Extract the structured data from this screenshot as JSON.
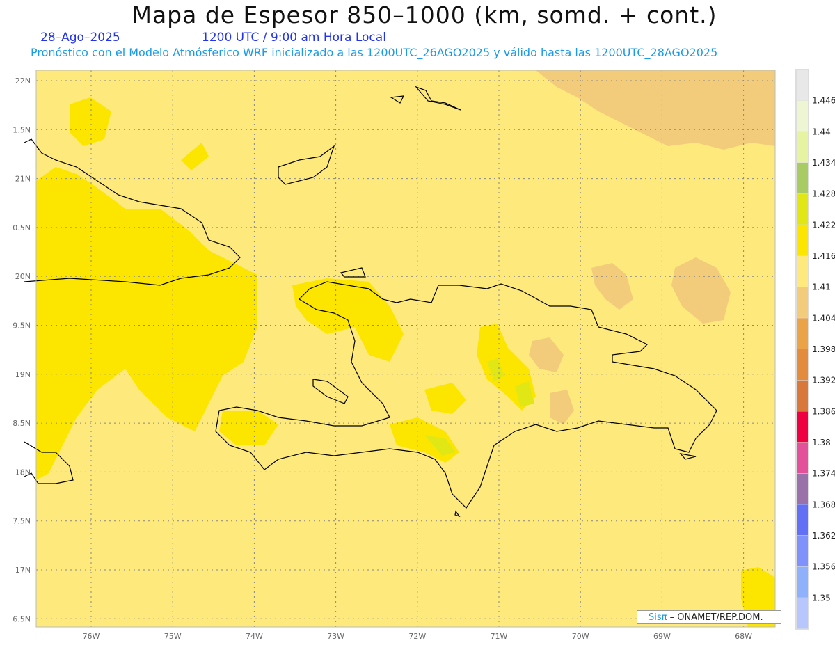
{
  "header": {
    "title": "Mapa de Espesor 850–1000 (km, somd. + cont.)",
    "date": "28–Ago–2025",
    "time": "1200 UTC / 9:00 am Hora Local",
    "subtitle": "Pronóstico con el Modelo Atmósferico WRF inicializado a las 1200UTC_26AGO2025 y válido hasta las  1200UTC_28AGO2025"
  },
  "map": {
    "lat_labels": [
      "22N",
      "1.5N",
      "21N",
      "0.5N",
      "20N",
      "9.5N",
      "19N",
      "8.5N",
      "18N",
      "7.5N",
      "17N",
      "6.5N"
    ],
    "lon_labels": [
      "76W",
      "75W",
      "74W",
      "73W",
      "72W",
      "71W",
      "70W",
      "69W",
      "68W"
    ],
    "background_color": "#fde97c",
    "high_color": "#fce600",
    "higher_color": "#e1e715",
    "low_color": "#f2cc7a",
    "coast_color": "#000000"
  },
  "colorbar": {
    "labels": [
      "1.446",
      "1.44",
      "1.434",
      "1.428",
      "1.422",
      "1.416",
      "1.41",
      "1.404",
      "1.398",
      "1.392",
      "1.386",
      "1.38",
      "1.374",
      "1.368",
      "1.362",
      "1.356",
      "1.35"
    ],
    "colors": [
      "#e8e8e8",
      "#eef5d3",
      "#e6f3a0",
      "#a8cb63",
      "#e1e715",
      "#fce600",
      "#fde97c",
      "#f2cc7a",
      "#eba347",
      "#e38c3d",
      "#d8783b",
      "#ef0040",
      "#e4519b",
      "#9a71a8",
      "#6270f6",
      "#7f92fc",
      "#8fb1fb",
      "#b7c7fd"
    ]
  },
  "credit": {
    "brand": "Sisπ",
    "text": " –  ONAMET/REP.DOM."
  }
}
